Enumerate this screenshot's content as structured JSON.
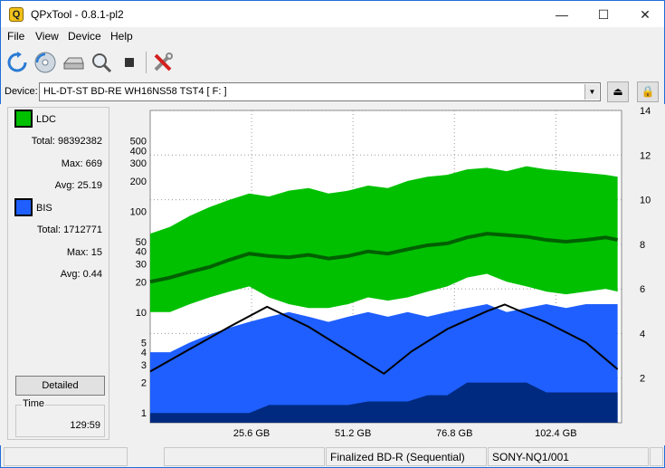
{
  "window": {
    "title": "QPxTool - 0.8.1-pl2",
    "app_icon_letter": "Q",
    "minimize": "—",
    "maximize": "☐",
    "close": "✕"
  },
  "menu": [
    "File",
    "View",
    "Device",
    "Help"
  ],
  "toolbar_icons": [
    "refresh-icon",
    "disc-scan-icon",
    "drive-icon",
    "zoom-icon",
    "stop-icon",
    "settings-icon"
  ],
  "device": {
    "label": "Device:",
    "value": "HL-DT-ST BD-RE  WH16NS58  TST4 [ F: ]",
    "arrow": "▼",
    "eject": "⏏",
    "lock": "🔒"
  },
  "ldc": {
    "label": "LDC",
    "color": "#00c000",
    "total_label": "Total:",
    "total": "98392382",
    "max_label": "Max:",
    "max": "669",
    "avg_label": "Avg:",
    "avg": "25.19"
  },
  "bis": {
    "label": "BIS",
    "color": "#1f5fff",
    "total_label": "Total:",
    "total": "1712771",
    "max_label": "Max:",
    "max": "15",
    "avg_label": "Avg:",
    "avg": "0.44"
  },
  "detailed_button": "Detailed",
  "time": {
    "label": "Time",
    "value": "129:59"
  },
  "status": [
    "",
    "",
    "Finalized BD-R (Sequential)",
    "SONY-NQ1/001",
    ""
  ],
  "chart_data": {
    "type": "area",
    "x_ticks": [
      "25.6 GB",
      "51.2 GB",
      "76.8 GB",
      "102.4 GB"
    ],
    "x_tick_values": [
      25.6,
      51.2,
      76.8,
      102.4
    ],
    "x_range": [
      0,
      119
    ],
    "y_left_scale": "log",
    "y_left_range": [
      0.8,
      1000
    ],
    "y_left_ticks": [
      "1",
      "2",
      "3",
      "4",
      "5",
      "10",
      "20",
      "30",
      "40",
      "50",
      "100",
      "200",
      "300",
      "400",
      "500"
    ],
    "y_left_tick_values": [
      1,
      2,
      3,
      4,
      5,
      10,
      20,
      30,
      40,
      50,
      100,
      200,
      300,
      400,
      500
    ],
    "y_right_range": [
      0,
      14
    ],
    "y_right_ticks": [
      "2",
      "4",
      "6",
      "8",
      "10",
      "12",
      "14"
    ],
    "y_right_tick_values": [
      2,
      4,
      6,
      8,
      10,
      12,
      14
    ],
    "grid": true,
    "series": [
      {
        "name": "LDC",
        "color": "#00c000",
        "avg_color": "#006000",
        "x": [
          0,
          5,
          10,
          15,
          20,
          25,
          30,
          35,
          40,
          45,
          50,
          55,
          60,
          65,
          70,
          75,
          80,
          85,
          90,
          95,
          100,
          105,
          110,
          115,
          118
        ],
        "max": [
          60,
          70,
          90,
          110,
          130,
          150,
          140,
          160,
          170,
          150,
          160,
          180,
          170,
          200,
          220,
          230,
          260,
          270,
          250,
          280,
          260,
          250,
          240,
          230,
          220
        ],
        "avg": [
          20,
          22,
          25,
          28,
          33,
          38,
          36,
          35,
          37,
          34,
          36,
          40,
          38,
          42,
          46,
          48,
          55,
          60,
          58,
          56,
          52,
          50,
          52,
          55,
          52
        ],
        "min": [
          10,
          10,
          12,
          14,
          16,
          18,
          14,
          12,
          11,
          11,
          12,
          14,
          13,
          14,
          16,
          18,
          22,
          24,
          20,
          18,
          16,
          15,
          16,
          17,
          16
        ]
      },
      {
        "name": "BIS",
        "color": "#1f5fff",
        "avg_color": "#002a80",
        "x": [
          0,
          5,
          10,
          15,
          20,
          25,
          30,
          35,
          40,
          45,
          50,
          55,
          60,
          65,
          70,
          75,
          80,
          85,
          90,
          95,
          100,
          105,
          110,
          115,
          118
        ],
        "max": [
          4,
          4,
          5,
          6,
          7,
          8,
          9,
          10,
          9,
          8,
          9,
          10,
          9,
          10,
          9,
          10,
          11,
          12,
          10,
          11,
          12,
          11,
          12,
          12,
          12
        ],
        "avg": [
          1,
          1,
          1,
          1,
          1,
          1,
          1.2,
          1.2,
          1.2,
          1.2,
          1.2,
          1.3,
          1.3,
          1.3,
          1.5,
          1.5,
          2,
          2,
          2,
          2,
          1.6,
          1.6,
          1.6,
          1.6,
          1.6
        ]
      },
      {
        "name": "Speed",
        "color": "#000000",
        "axis": "right",
        "x": [
          0,
          10,
          20,
          29.5,
          40,
          50,
          59,
          66,
          75,
          85,
          89.5,
          100,
          110,
          118
        ],
        "values": [
          2.3,
          3.3,
          4.3,
          5.2,
          4.3,
          3.2,
          2.2,
          3.2,
          4.2,
          5.0,
          5.3,
          4.5,
          3.6,
          2.4
        ]
      }
    ]
  }
}
